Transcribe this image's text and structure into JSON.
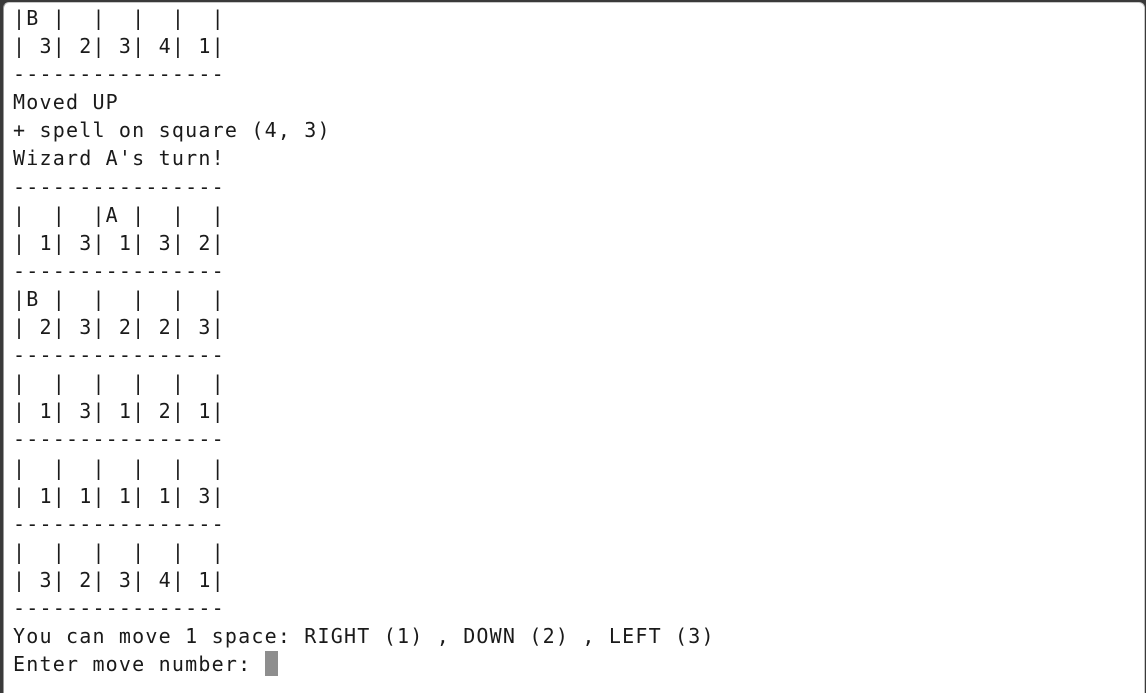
{
  "terminal": {
    "lines": [
      "|B |  |  |  |  |",
      "| 3| 2| 3| 4| 1|",
      "----------------",
      "Moved UP",
      "+ spell on square (4, 3)",
      "Wizard A's turn!",
      "----------------",
      "|  |  |A |  |  |",
      "| 1| 3| 1| 3| 2|",
      "----------------",
      "|B |  |  |  |  |",
      "| 2| 3| 2| 2| 3|",
      "----------------",
      "|  |  |  |  |  |",
      "| 1| 3| 1| 2| 1|",
      "----------------",
      "|  |  |  |  |  |",
      "| 1| 1| 1| 1| 3|",
      "----------------",
      "|  |  |  |  |  |",
      "| 3| 2| 3| 4| 1|",
      "----------------",
      "You can move 1 space: RIGHT (1) , DOWN (2) , LEFT (3)"
    ],
    "prompt": "Enter move number: ",
    "input_value": ""
  }
}
